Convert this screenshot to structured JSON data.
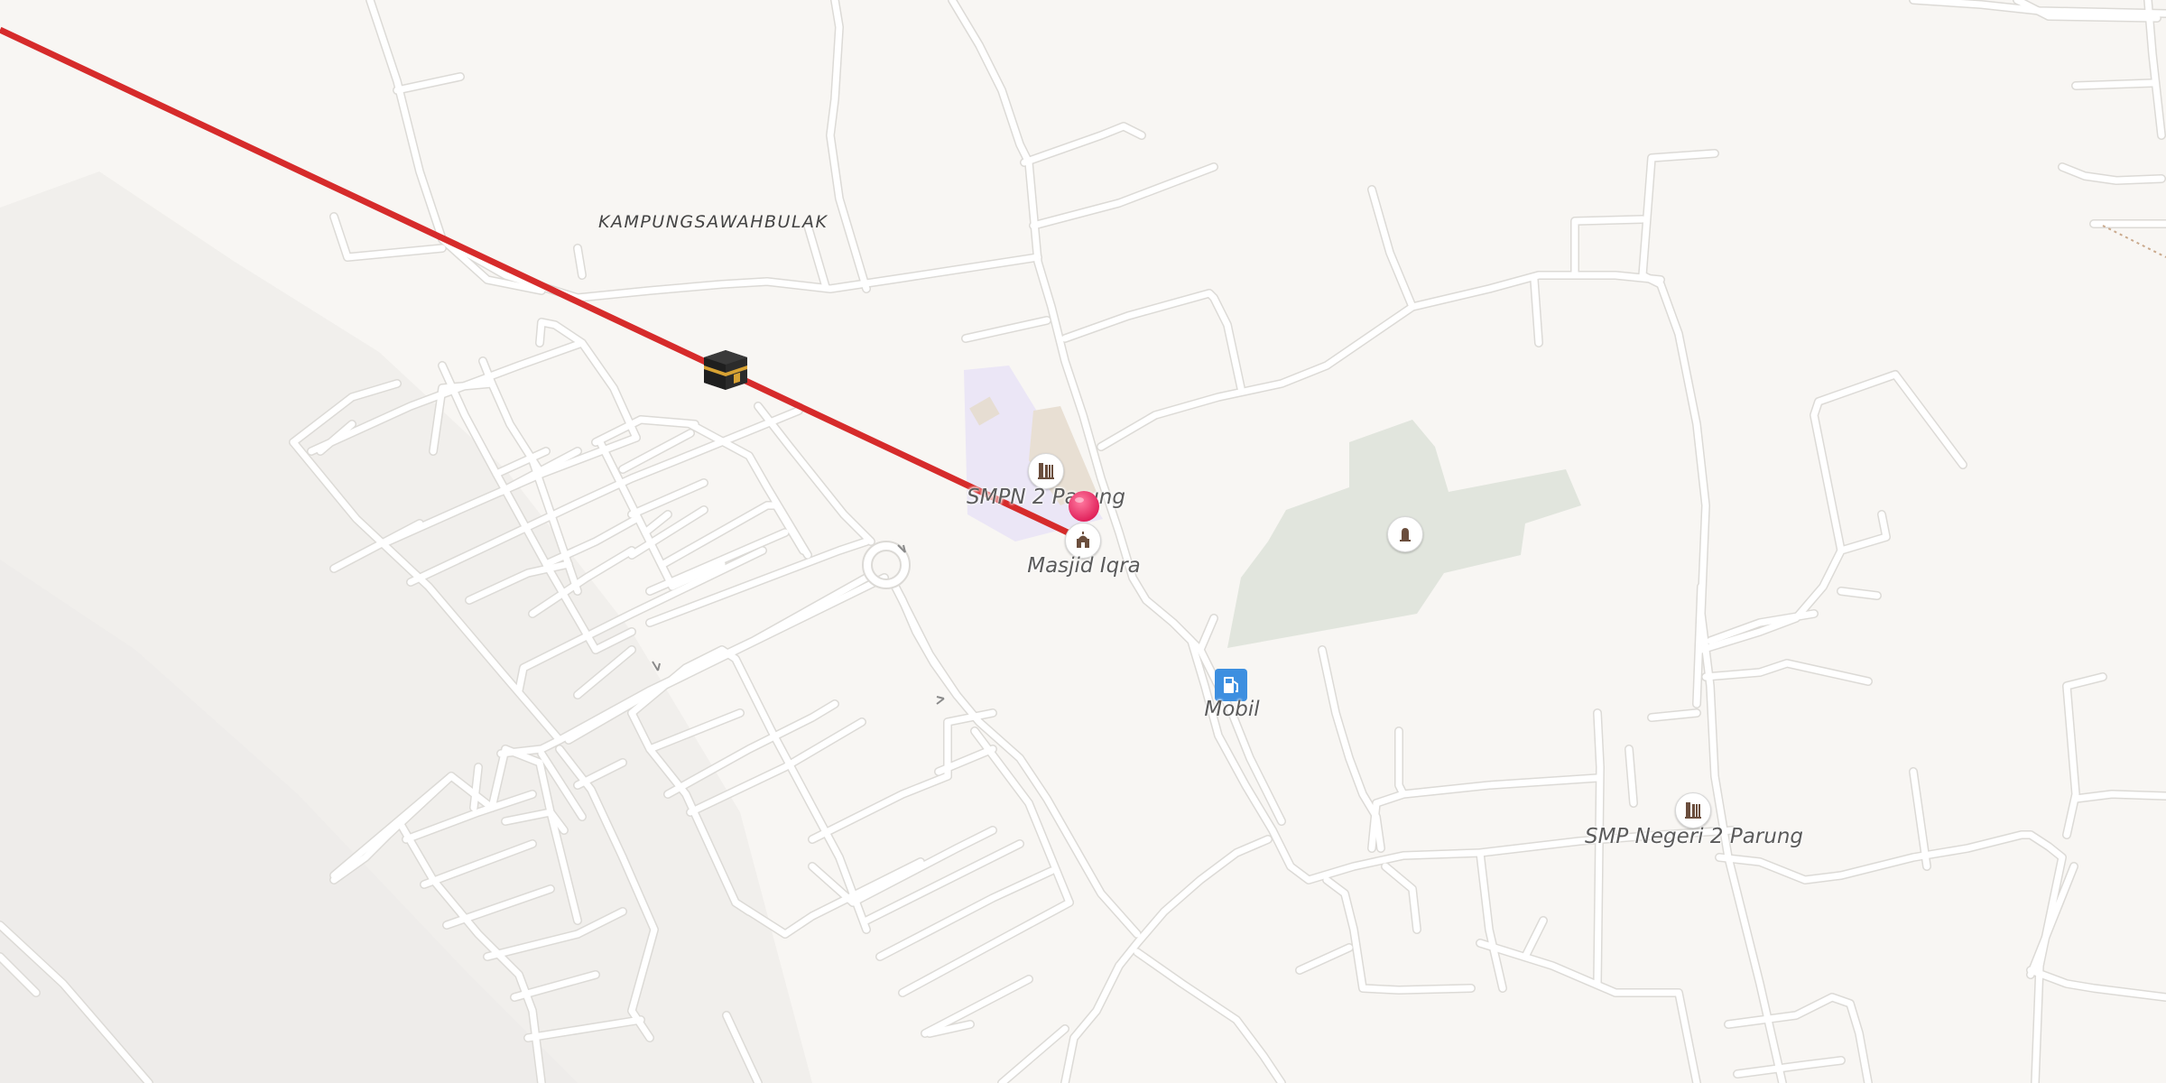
{
  "map": {
    "place_label": "KAMPUNGSAWAHBULAK",
    "pois": [
      {
        "id": "smpn2",
        "label": "SMPN 2 Parung",
        "icon": "school-icon"
      },
      {
        "id": "masjid",
        "label": "Masjid Iqra",
        "icon": "mosque-icon"
      },
      {
        "id": "mobil",
        "label": "Mobil",
        "icon": "fuel-station-icon"
      },
      {
        "id": "smpnegeri2",
        "label": "SMP Negeri 2 Parung",
        "icon": "school-icon"
      },
      {
        "id": "cemetery",
        "label": "",
        "icon": "grave-icon"
      }
    ],
    "markers": {
      "kaaba": {
        "icon": "kaaba-icon"
      },
      "location": {
        "icon": "location-pin-icon",
        "color": "#e8336b"
      }
    },
    "qibla_line": {
      "color": "#d62b2b"
    },
    "colors": {
      "background": "#f8f6f3",
      "road": "#ffffff",
      "road_casing": "#dcdad6",
      "school_area": "#ebe6f6",
      "green_area": "#e1e5dd",
      "fuel_badge": "#3d8fe0"
    }
  }
}
